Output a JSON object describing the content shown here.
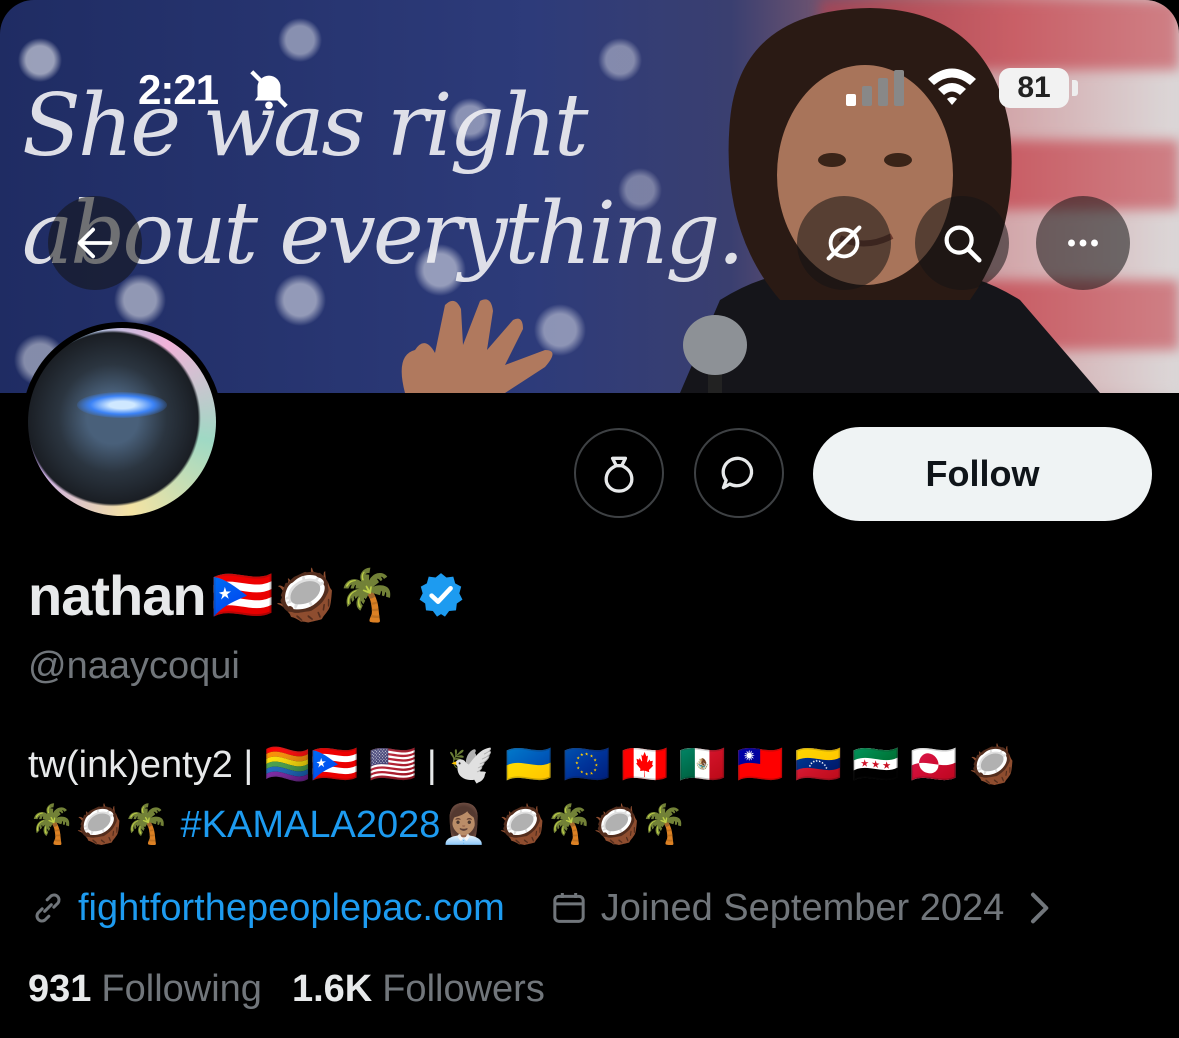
{
  "status_bar": {
    "time": "2:21",
    "battery": "81"
  },
  "banner": {
    "text_line1": "She was right",
    "text_line2": "about everything."
  },
  "actions": {
    "follow_label": "Follow"
  },
  "profile": {
    "display_name": "nathan",
    "name_emojis": "🇵🇷🥥🌴",
    "handle": "@naaycoqui",
    "bio_line1_text": "tw(ink)enty2 | ",
    "bio_line1_emojis": "🏳️‍🌈🇵🇷 🇺🇸 | 🕊️ 🇺🇦 🇪🇺 🇨🇦 🇲🇽 🇹🇼 🇻🇪 🇸🇾 🇬🇱 🥥",
    "bio_line2_emojis_before": "🌴🥥🌴 ",
    "hashtag": "#KAMALA2028",
    "bio_line2_emojis_after": "👩🏽‍💼 🥥🌴🥥🌴",
    "website": "fightforthepeoplepac.com",
    "joined": "Joined September 2024"
  },
  "stats": {
    "following_count": "931",
    "following_label": "Following",
    "followers_count": "1.6K",
    "followers_label": "Followers"
  },
  "colors": {
    "accent": "#1d9bf0",
    "muted": "#71767b",
    "text": "#e7e9ea"
  },
  "icons": [
    "bell-muted-icon",
    "signal-icon",
    "wifi-icon",
    "back-arrow-icon",
    "grok-icon",
    "search-icon",
    "more-icon",
    "tip-jar-icon",
    "message-icon",
    "verified-badge-icon",
    "link-icon",
    "calendar-icon",
    "chevron-right-icon"
  ]
}
